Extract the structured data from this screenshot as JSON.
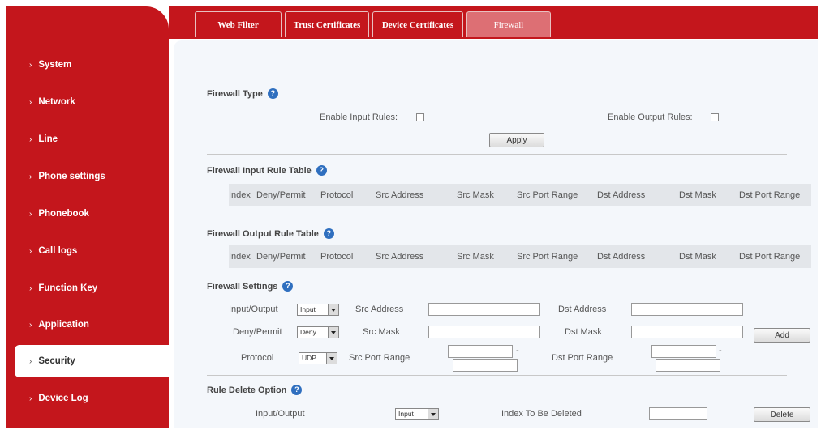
{
  "tabs": [
    {
      "label": "Web Filter",
      "active": false
    },
    {
      "label": "Trust Certificates",
      "active": false
    },
    {
      "label": "Device Certificates",
      "active": false
    },
    {
      "label": "Firewall",
      "active": true
    }
  ],
  "sidebar": {
    "items": [
      {
        "label": "System"
      },
      {
        "label": "Network"
      },
      {
        "label": "Line"
      },
      {
        "label": "Phone settings"
      },
      {
        "label": "Phonebook"
      },
      {
        "label": "Call logs"
      },
      {
        "label": "Function Key"
      },
      {
        "label": "Application"
      },
      {
        "label": "Security",
        "active": true
      },
      {
        "label": "Device Log"
      }
    ],
    "chevron": "›"
  },
  "firewall_type": {
    "title": "Firewall Type",
    "enable_input_label": "Enable Input Rules:",
    "enable_output_label": "Enable Output Rules:",
    "enable_input_checked": false,
    "enable_output_checked": false,
    "apply_label": "Apply"
  },
  "input_table": {
    "title": "Firewall Input Rule Table",
    "columns": [
      "Index",
      "Deny/Permit",
      "Protocol",
      "Src Address",
      "Src Mask",
      "Src Port Range",
      "Dst Address",
      "Dst Mask",
      "Dst Port Range"
    ]
  },
  "output_table": {
    "title": "Firewall Output Rule Table",
    "columns": [
      "Index",
      "Deny/Permit",
      "Protocol",
      "Src Address",
      "Src Mask",
      "Src Port Range",
      "Dst Address",
      "Dst Mask",
      "Dst Port Range"
    ]
  },
  "settings": {
    "title": "Firewall Settings",
    "input_output_label": "Input/Output",
    "input_output_value": "Input",
    "deny_permit_label": "Deny/Permit",
    "deny_permit_value": "Deny",
    "protocol_label": "Protocol",
    "protocol_value": "UDP",
    "src_address_label": "Src Address",
    "src_mask_label": "Src Mask",
    "src_port_range_label": "Src Port Range",
    "dst_address_label": "Dst Address",
    "dst_mask_label": "Dst Mask",
    "dst_port_range_label": "Dst Port Range",
    "range_sep": "-",
    "add_label": "Add"
  },
  "delete": {
    "title": "Rule Delete Option",
    "input_output_label": "Input/Output",
    "input_output_value": "Input",
    "index_label": "Index To Be Deleted",
    "delete_label": "Delete"
  },
  "icons": {
    "help": "?"
  },
  "colors": {
    "brand": "#c4161c",
    "active_tab": "#dd6f74",
    "help": "#2f6fbf"
  }
}
